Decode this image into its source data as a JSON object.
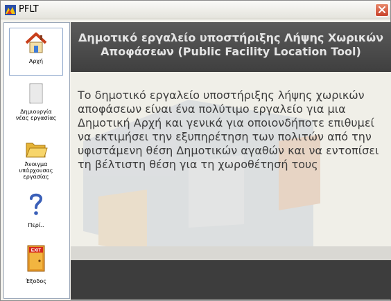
{
  "window": {
    "title": "PFLT"
  },
  "sidebar": {
    "items": [
      {
        "label": "Αρχή",
        "icon": "home-icon"
      },
      {
        "label": "Δημιουργία νέας εργασίας",
        "icon": "new-document-icon"
      },
      {
        "label": "Άνοιγμα υπάρχουσας εργασίας",
        "icon": "open-folder-icon"
      },
      {
        "label": "Περί..",
        "icon": "help-question-icon"
      },
      {
        "label": "Έξοδος",
        "icon": "exit-door-icon"
      }
    ],
    "exit_sign": "EXIT"
  },
  "header": {
    "title": "Δημοτικό εργαλείο υποστήριξης Λήψης Χωρικών Αποφάσεων (Public Facility Location Tool)"
  },
  "main": {
    "description": "Το δημοτικό εργαλείο υποστήριξης λήψης χωρικών αποφάσεων είναι ένα πολύτιμο εργαλείο για μια Δημοτική Αρχή και γενικά για οποιονδήποτε επιθυμεί να εκτιμήσει την εξυπηρέτηση των πολιτών από την υφιστάμενη θέση Δημοτικών αγαθών και να εντοπίσει τη βέλτιστη θέση για τη χωροθέτησή τους"
  }
}
